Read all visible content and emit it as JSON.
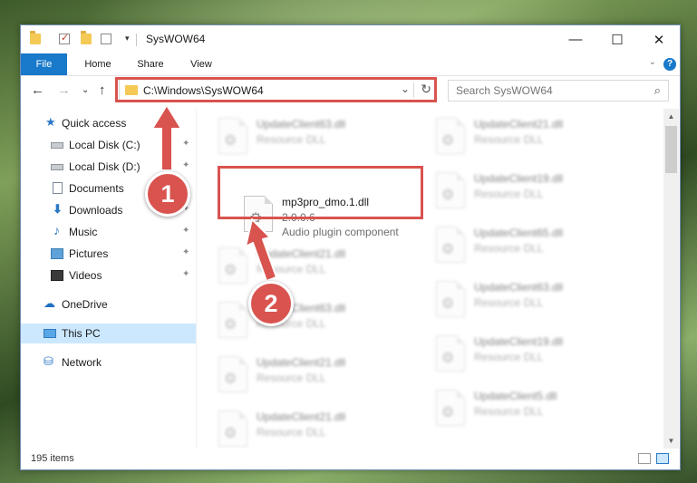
{
  "window": {
    "title": "SysWOW64",
    "controls": {
      "minimize": "—",
      "maximize": "☐",
      "close": "✕"
    }
  },
  "ribbon": {
    "tabs": [
      {
        "label": "File",
        "active": true
      },
      {
        "label": "Home"
      },
      {
        "label": "Share"
      },
      {
        "label": "View"
      }
    ],
    "help": "?",
    "expand": "⌄"
  },
  "nav": {
    "back": "←",
    "forward": "→",
    "recent": "⌄",
    "up": "↑",
    "address": "C:\\Windows\\SysWOW64",
    "address_chevron": "⌄",
    "refresh": "↻",
    "search_placeholder": "Search SysWOW64",
    "search_icon": "⌕"
  },
  "sidebar": {
    "items": [
      {
        "label": "Quick access",
        "icon": "star-icon",
        "glyph": "★"
      },
      {
        "label": "Local Disk (C:)",
        "icon": "drive-icon",
        "pinned": true
      },
      {
        "label": "Local Disk (D:)",
        "icon": "drive-icon",
        "pinned": true
      },
      {
        "label": "Documents",
        "icon": "documents-icon",
        "pinned": true
      },
      {
        "label": "Downloads",
        "icon": "download-icon",
        "glyph": "⬇",
        "pinned": true
      },
      {
        "label": "Music",
        "icon": "music-icon",
        "glyph": "♪",
        "pinned": true
      },
      {
        "label": "Pictures",
        "icon": "pictures-icon",
        "pinned": true
      },
      {
        "label": "Videos",
        "icon": "videos-icon",
        "pinned": true
      },
      {
        "label": "OneDrive",
        "icon": "cloud-icon",
        "glyph": "☁"
      },
      {
        "label": "This PC",
        "icon": "computer-icon",
        "selected": true
      },
      {
        "label": "Network",
        "icon": "network-icon",
        "glyph": "⛁"
      }
    ],
    "pin_glyph": "✦"
  },
  "files": {
    "highlighted": {
      "name": "mp3pro_dmo.1.dll",
      "version": "2.0.0.6",
      "description": "Audio plugin component"
    },
    "background": [
      {
        "name": "UpdateClient63.dll",
        "type": "Resource DLL"
      },
      {
        "name": "UpdateClient21.dll",
        "type": "Resource DLL"
      },
      {
        "name": "UpdateClient19.dll",
        "type": "Resource DLL"
      },
      {
        "name": "UpdateClient21.dll",
        "type": "Resource DLL"
      },
      {
        "name": "UpdateClient65.dll",
        "type": "Resource DLL"
      },
      {
        "name": "UpdateClient63.dll",
        "type": "Resource DLL"
      },
      {
        "name": "UpdateClient63.dll",
        "type": "Resource DLL"
      },
      {
        "name": "UpdateClient21.dll",
        "type": "Resource DLL"
      },
      {
        "name": "UpdateClient19.dll",
        "type": "Resource DLL"
      },
      {
        "name": "UpdateClient21.dll",
        "type": "Resource DLL"
      },
      {
        "name": "UpdateClient5.dll",
        "type": "Resource DLL"
      }
    ],
    "gear_glyph": "⚙"
  },
  "status": {
    "item_count": "195 items"
  },
  "annotations": {
    "step1": "1",
    "step2": "2",
    "color": "#d9534f"
  }
}
